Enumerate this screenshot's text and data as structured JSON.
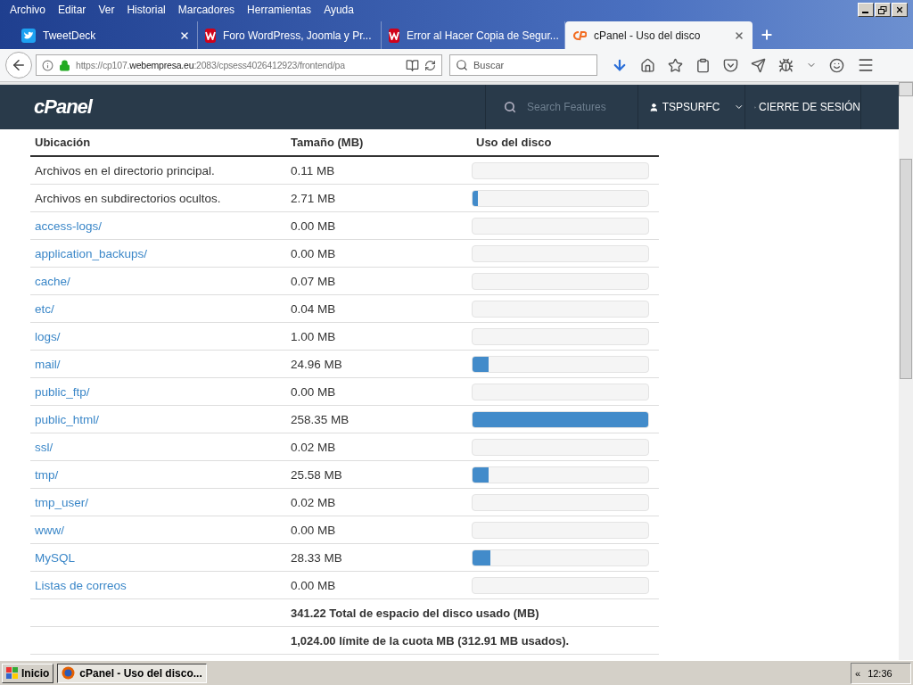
{
  "menu_bar": [
    "Archivo",
    "Editar",
    "Ver",
    "Historial",
    "Marcadores",
    "Herramientas",
    "Ayuda"
  ],
  "tabs": [
    {
      "label": "TweetDeck",
      "selected": false
    },
    {
      "label": "Foro WordPress, Joomla y Pr...",
      "selected": false
    },
    {
      "label": "Error al Hacer Copia de Segur...",
      "selected": false
    },
    {
      "label": "cPanel - Uso del disco",
      "selected": true
    }
  ],
  "address": {
    "prefix": "https://cp107.",
    "host": "webempresa.eu",
    "rest": ":2083/cpsess4026412923/frontend/pa"
  },
  "search": {
    "placeholder": "Buscar"
  },
  "cpanel_header": {
    "logo": "cPanel",
    "search_placeholder": "Search Features",
    "user": "TSPSURFC",
    "logout": "CIERRE DE SESIÓN"
  },
  "table": {
    "columns": [
      "Ubicación",
      "Tamaño (MB)",
      "Uso del disco"
    ],
    "rows": [
      {
        "kind": "text",
        "name": "Archivos en el directorio principal.",
        "size": "0.11 MB",
        "level": 0
      },
      {
        "kind": "text",
        "name": "Archivos en subdirectorios ocultos.",
        "size": "2.71 MB",
        "level": 0.03
      },
      {
        "kind": "link",
        "name": "access-logs/",
        "size": "0.00 MB",
        "level": 0
      },
      {
        "kind": "link",
        "name": "application_backups/",
        "size": "0.00 MB",
        "level": 0
      },
      {
        "kind": "link",
        "name": "cache/",
        "size": "0.07 MB",
        "level": 0
      },
      {
        "kind": "link",
        "name": "etc/",
        "size": "0.04 MB",
        "level": 0
      },
      {
        "kind": "link",
        "name": "logs/",
        "size": "1.00 MB",
        "level": 0
      },
      {
        "kind": "link",
        "name": "mail/",
        "size": "24.96 MB",
        "level": 0.09
      },
      {
        "kind": "link",
        "name": "public_ftp/",
        "size": "0.00 MB",
        "level": 0
      },
      {
        "kind": "link",
        "name": "public_html/",
        "size": "258.35 MB",
        "level": 1
      },
      {
        "kind": "link",
        "name": "ssl/",
        "size": "0.02 MB",
        "level": 0
      },
      {
        "kind": "link",
        "name": "tmp/",
        "size": "25.58 MB",
        "level": 0.09
      },
      {
        "kind": "link",
        "name": "tmp_user/",
        "size": "0.02 MB",
        "level": 0
      },
      {
        "kind": "link",
        "name": "www/",
        "size": "0.00 MB",
        "level": 0
      },
      {
        "kind": "link",
        "name": "MySQL",
        "size": "28.33 MB",
        "level": 0.1
      },
      {
        "kind": "link",
        "name": "Listas de correos",
        "size": "0.00 MB",
        "level": 0
      }
    ],
    "totals": [
      "341.22 Total de espacio del disco usado (MB)",
      "1,024.00 límite de la cuota MB (312.91 MB usados)."
    ]
  },
  "taskbar": {
    "start": "Inicio",
    "task": "cPanel - Uso del disco...",
    "expand": "«",
    "clock": "12:36"
  }
}
